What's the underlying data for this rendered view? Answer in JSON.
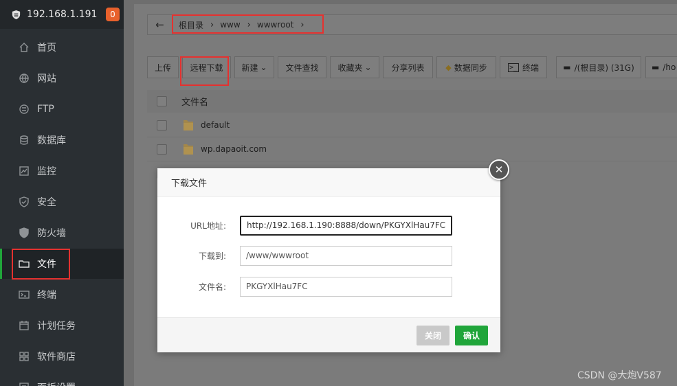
{
  "sidebar": {
    "server_ip": "192.168.1.191",
    "badge_count": "0",
    "items": [
      {
        "label": "首页",
        "icon": "home-icon"
      },
      {
        "label": "网站",
        "icon": "globe-icon"
      },
      {
        "label": "FTP",
        "icon": "ftp-icon"
      },
      {
        "label": "数据库",
        "icon": "database-icon"
      },
      {
        "label": "监控",
        "icon": "monitor-icon"
      },
      {
        "label": "安全",
        "icon": "shield-check-icon"
      },
      {
        "label": "防火墙",
        "icon": "firewall-icon"
      },
      {
        "label": "文件",
        "icon": "folder-icon"
      },
      {
        "label": "终端",
        "icon": "terminal-icon"
      },
      {
        "label": "计划任务",
        "icon": "calendar-icon"
      },
      {
        "label": "软件商店",
        "icon": "grid-icon"
      },
      {
        "label": "面板设置",
        "icon": "settings-icon"
      }
    ]
  },
  "breadcrumb": {
    "segments": [
      "根目录",
      "www",
      "wwwroot"
    ]
  },
  "toolbar": {
    "upload": "上传",
    "remote_download": "远程下载",
    "new": "新建",
    "file_search": "文件查找",
    "favorites": "收藏夹",
    "share_list": "分享列表",
    "data_sync": "数据同步",
    "terminal": "终端",
    "disk_root": "/(根目录) (31G)",
    "disk_home": "/ho"
  },
  "file_table": {
    "header_name": "文件名",
    "rows": [
      "default",
      "wp.dapaoit.com"
    ]
  },
  "dialog": {
    "title": "下载文件",
    "url_label": "URL地址:",
    "url_value": "http://192.168.1.190:8888/down/PKGYXlHau7FC",
    "dest_label": "下载到:",
    "dest_value": "/www/wwwroot",
    "filename_label": "文件名:",
    "filename_value": "PKGYXlHau7FC",
    "close_button": "关闭",
    "confirm_button": "确认"
  },
  "watermark": "CSDN @大炮V587",
  "colors": {
    "accent_green": "#20a53a",
    "badge_orange": "#e8612c",
    "highlight_red": "#e5312f"
  }
}
